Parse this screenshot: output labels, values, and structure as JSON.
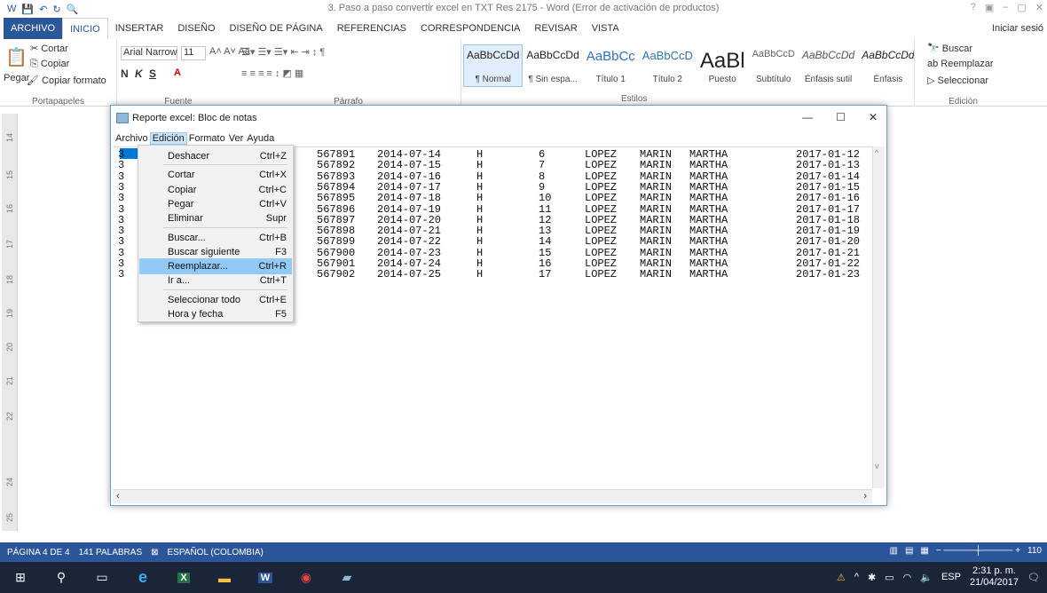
{
  "word": {
    "qat_icons": [
      "save-icon",
      "undo-icon",
      "redo-icon",
      "print-preview-icon"
    ],
    "title": "3. Paso a paso convertir excel en TXT Res 2175 - Word (Error de activación de productos)",
    "window_controls": [
      "?",
      "▣",
      "–",
      "▢",
      "✕"
    ],
    "tabs": [
      "ARCHIVO",
      "INICIO",
      "INSERTAR",
      "DISEÑO",
      "DISEÑO DE PÁGINA",
      "REFERENCIAS",
      "CORRESPONDENCIA",
      "REVISAR",
      "VISTA"
    ],
    "signin": "Iniciar sesió",
    "clipboard": {
      "paste": "Pegar",
      "cut": "Cortar",
      "copy": "Copiar",
      "format": "Copiar formato",
      "label": "Portapapeles"
    },
    "font": {
      "name": "Arial Narrow",
      "size": "11",
      "bold": "N",
      "italic": "K",
      "underline": "S",
      "label": "Fuente"
    },
    "paragraph_label": "Párrafo",
    "styles": [
      {
        "preview": "AaBbCcDd",
        "name": "¶ Normal"
      },
      {
        "preview": "AaBbCcDd",
        "name": "¶ Sin espa..."
      },
      {
        "preview": "AaBbCc",
        "name": "Título 1"
      },
      {
        "preview": "AaBbCcD",
        "name": "Título 2"
      },
      {
        "preview": "AaBl",
        "name": "Puesto"
      },
      {
        "preview": "AaBbCcD",
        "name": "Subtítulo"
      },
      {
        "preview": "AaBbCcDd",
        "name": "Énfasis sutil"
      },
      {
        "preview": "AaBbCcDd",
        "name": "Énfasis"
      }
    ],
    "styles_label": "Estilos",
    "editing": {
      "find": "Buscar",
      "replace": "Reemplazar",
      "select": "Seleccionar",
      "label": "Edición"
    },
    "ruler": [
      "14",
      "15",
      "16",
      "17",
      "18",
      "19",
      "20",
      "21",
      "22",
      "24",
      "25"
    ],
    "status": {
      "page": "PÁGINA 4 DE 4",
      "words": "141 PALABRAS",
      "lang": "ESPAÑOL (COLOMBIA)",
      "zoom": "110"
    }
  },
  "notepad": {
    "title": "Reporte excel: Bloc de notas",
    "menu": [
      "Archivo",
      "Edición",
      "Formato",
      "Ver",
      "Ayuda"
    ],
    "rows": [
      [
        "3",
        "567891",
        "2014-07-14",
        "H",
        "6",
        "LOPEZ",
        "MARIN",
        "MARTHA",
        "2017-01-12"
      ],
      [
        "3",
        "567892",
        "2014-07-15",
        "H",
        "7",
        "LOPEZ",
        "MARIN",
        "MARTHA",
        "2017-01-13"
      ],
      [
        "3",
        "567893",
        "2014-07-16",
        "H",
        "8",
        "LOPEZ",
        "MARIN",
        "MARTHA",
        "2017-01-14"
      ],
      [
        "3",
        "567894",
        "2014-07-17",
        "H",
        "9",
        "LOPEZ",
        "MARIN",
        "MARTHA",
        "2017-01-15"
      ],
      [
        "3",
        "567895",
        "2014-07-18",
        "H",
        "10",
        "LOPEZ",
        "MARIN",
        "MARTHA",
        "2017-01-16"
      ],
      [
        "3",
        "567896",
        "2014-07-19",
        "H",
        "11",
        "LOPEZ",
        "MARIN",
        "MARTHA",
        "2017-01-17"
      ],
      [
        "3",
        "567897",
        "2014-07-20",
        "H",
        "12",
        "LOPEZ",
        "MARIN",
        "MARTHA",
        "2017-01-18"
      ],
      [
        "3",
        "567898",
        "2014-07-21",
        "H",
        "13",
        "LOPEZ",
        "MARIN",
        "MARTHA",
        "2017-01-19"
      ],
      [
        "3",
        "567899",
        "2014-07-22",
        "H",
        "14",
        "LOPEZ",
        "MARIN",
        "MARTHA",
        "2017-01-20"
      ],
      [
        "3",
        "567900",
        "2014-07-23",
        "H",
        "15",
        "LOPEZ",
        "MARIN",
        "MARTHA",
        "2017-01-21"
      ],
      [
        "3",
        "567901",
        "2014-07-24",
        "H",
        "16",
        "LOPEZ",
        "MARIN",
        "MARTHA",
        "2017-01-22"
      ],
      [
        "3",
        "567902",
        "2014-07-25",
        "H",
        "17",
        "LOPEZ",
        "MARIN",
        "MARTHA",
        "2017-01-23"
      ]
    ],
    "edit_menu": [
      {
        "label": "Deshacer",
        "key": "Ctrl+Z"
      },
      {
        "sep": true
      },
      {
        "label": "Cortar",
        "key": "Ctrl+X"
      },
      {
        "label": "Copiar",
        "key": "Ctrl+C"
      },
      {
        "label": "Pegar",
        "key": "Ctrl+V"
      },
      {
        "label": "Eliminar",
        "key": "Supr"
      },
      {
        "sep": true
      },
      {
        "label": "Buscar...",
        "key": "Ctrl+B"
      },
      {
        "label": "Buscar siguiente",
        "key": "F3"
      },
      {
        "label": "Reemplazar...",
        "key": "Ctrl+R",
        "highlight": true
      },
      {
        "label": "Ir a...",
        "key": "Ctrl+T"
      },
      {
        "sep": true
      },
      {
        "label": "Seleccionar todo",
        "key": "Ctrl+E"
      },
      {
        "label": "Hora y fecha",
        "key": "F5"
      }
    ]
  },
  "taskbar": {
    "apps": [
      "windows-start-icon",
      "search-icon",
      "task-view-icon",
      "edge-icon",
      "excel-icon",
      "file-explorer-icon",
      "word-icon",
      "chrome-icon",
      "notepad-icon"
    ],
    "lang": "ESP",
    "time": "2:31 p. m.",
    "date": "21/04/2017"
  }
}
